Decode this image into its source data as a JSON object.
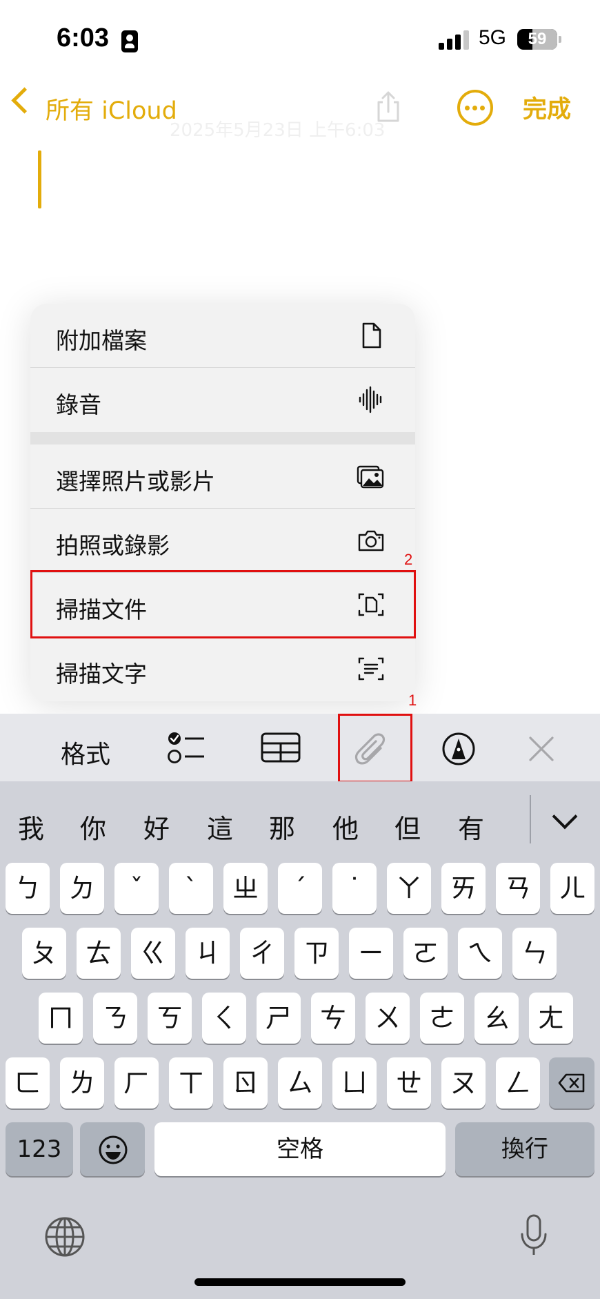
{
  "status_bar": {
    "time": "6:03",
    "network": "5G",
    "battery": "59"
  },
  "nav": {
    "back_label": "所有 iCloud",
    "done_label": "完成",
    "date_ghost": "2025年5月23日 上午6:03"
  },
  "menu": {
    "items": [
      {
        "label": "附加檔案",
        "icon": "document-icon"
      },
      {
        "label": "錄音",
        "icon": "waveform-icon"
      },
      {
        "label": "選擇照片或影片",
        "icon": "photo-library-icon"
      },
      {
        "label": "拍照或錄影",
        "icon": "camera-icon"
      },
      {
        "label": "掃描文件",
        "icon": "document-scan-icon"
      },
      {
        "label": "掃描文字",
        "icon": "text-scan-icon"
      }
    ]
  },
  "annotations": {
    "step1": "1",
    "step2": "2"
  },
  "toolbar": {
    "format_label": "格式",
    "icons": [
      "checklist-icon",
      "table-icon",
      "paperclip-icon",
      "markup-icon",
      "close-icon"
    ]
  },
  "keyboard": {
    "candidates": [
      "我",
      "你",
      "好",
      "這",
      "那",
      "他",
      "但",
      "有"
    ],
    "row1": [
      "ㄅ",
      "ㄉ",
      "ˇ",
      "ˋ",
      "ㄓ",
      "ˊ",
      "˙",
      "ㄚ",
      "ㄞ",
      "ㄢ",
      "ㄦ"
    ],
    "row2": [
      "ㄆ",
      "ㄊ",
      "ㄍ",
      "ㄐ",
      "ㄔ",
      "ㄗ",
      "ㄧ",
      "ㄛ",
      "ㄟ",
      "ㄣ"
    ],
    "row3": [
      "ㄇ",
      "ㄋ",
      "ㄎ",
      "ㄑ",
      "ㄕ",
      "ㄘ",
      "ㄨ",
      "ㄜ",
      "ㄠ",
      "ㄤ"
    ],
    "row4": [
      "ㄈ",
      "ㄌ",
      "ㄏ",
      "ㄒ",
      "ㄖ",
      "ㄙ",
      "ㄩ",
      "ㄝ",
      "ㄡ",
      "ㄥ"
    ],
    "numbers_label": "123",
    "space_label": "空格",
    "return_label": "換行"
  },
  "colors": {
    "accent": "#e3ac0b",
    "annotation": "#e01010",
    "keyboard_bg": "#d0d2d9"
  }
}
